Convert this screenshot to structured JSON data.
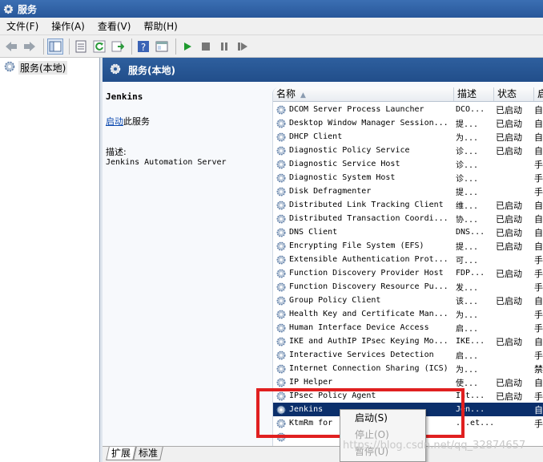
{
  "window": {
    "title": "服务"
  },
  "menu": [
    "文件(F)",
    "操作(A)",
    "查看(V)",
    "帮助(H)"
  ],
  "toolbar_icons": [
    "back-icon",
    "forward-icon",
    "show-tree-icon",
    "properties-icon",
    "refresh-icon",
    "export-icon",
    "help-icon",
    "console-icon",
    "start-icon",
    "stop-icon",
    "pause-icon",
    "restart-icon"
  ],
  "tree": {
    "root_label": "服务(本地)"
  },
  "panel": {
    "title": "服务(本地)"
  },
  "info": {
    "service_name": "Jenkins",
    "start_link": "启动",
    "start_suffix": "此服务",
    "desc_label": "描述:",
    "desc_text": "Jenkins Automation Server"
  },
  "columns": {
    "name": "名称",
    "desc": "描述",
    "status": "状态",
    "startup": "启"
  },
  "rows": [
    {
      "name": "DCOM Server Process Launcher",
      "desc": "DCO...",
      "status": "已启动",
      "startup": "自"
    },
    {
      "name": "Desktop Window Manager Session...",
      "desc": "提...",
      "status": "已启动",
      "startup": "自"
    },
    {
      "name": "DHCP Client",
      "desc": "为...",
      "status": "已启动",
      "startup": "自"
    },
    {
      "name": "Diagnostic Policy Service",
      "desc": "诊...",
      "status": "已启动",
      "startup": "自"
    },
    {
      "name": "Diagnostic Service Host",
      "desc": "诊...",
      "status": "",
      "startup": "手"
    },
    {
      "name": "Diagnostic System Host",
      "desc": "诊...",
      "status": "",
      "startup": "手"
    },
    {
      "name": "Disk Defragmenter",
      "desc": "提...",
      "status": "",
      "startup": "手"
    },
    {
      "name": "Distributed Link Tracking Client",
      "desc": "维...",
      "status": "已启动",
      "startup": "自"
    },
    {
      "name": "Distributed Transaction Coordi...",
      "desc": "协...",
      "status": "已启动",
      "startup": "自"
    },
    {
      "name": "DNS Client",
      "desc": "DNS...",
      "status": "已启动",
      "startup": "自"
    },
    {
      "name": "Encrypting File System (EFS)",
      "desc": "提...",
      "status": "已启动",
      "startup": "自"
    },
    {
      "name": "Extensible Authentication Prot...",
      "desc": "可...",
      "status": "",
      "startup": "手"
    },
    {
      "name": "Function Discovery Provider Host",
      "desc": "FDP...",
      "status": "已启动",
      "startup": "手"
    },
    {
      "name": "Function Discovery Resource Pu...",
      "desc": "发...",
      "status": "",
      "startup": "手"
    },
    {
      "name": "Group Policy Client",
      "desc": "该...",
      "status": "已启动",
      "startup": "自"
    },
    {
      "name": "Health Key and Certificate Man...",
      "desc": "为...",
      "status": "",
      "startup": "手"
    },
    {
      "name": "Human Interface Device Access",
      "desc": "启...",
      "status": "",
      "startup": "手"
    },
    {
      "name": "IKE and AuthIP IPsec Keying Mo...",
      "desc": "IKE...",
      "status": "已启动",
      "startup": "自"
    },
    {
      "name": "Interactive Services Detection",
      "desc": "启...",
      "status": "",
      "startup": "手"
    },
    {
      "name": "Internet Connection Sharing (ICS)",
      "desc": "为...",
      "status": "",
      "startup": "禁"
    },
    {
      "name": "IP Helper",
      "desc": "使...",
      "status": "已启动",
      "startup": "自"
    },
    {
      "name": "IPsec Policy Agent",
      "desc": "Int...",
      "status": "已启动",
      "startup": "手"
    },
    {
      "name": "Jenkins",
      "desc": "Jen...",
      "status": "",
      "startup": "自"
    },
    {
      "name": "KtmRm for ",
      "desc": "...et...",
      "status": "",
      "startup": "手"
    },
    {
      "name": "",
      "desc": "",
      "status": "",
      "startup": ""
    }
  ],
  "tabs": [
    "扩展",
    "标准"
  ],
  "context_menu": [
    "启动(S)",
    "停止(O)",
    "暂停(U)"
  ],
  "watermark": "https://blog.csdn.net/qq_32874657"
}
